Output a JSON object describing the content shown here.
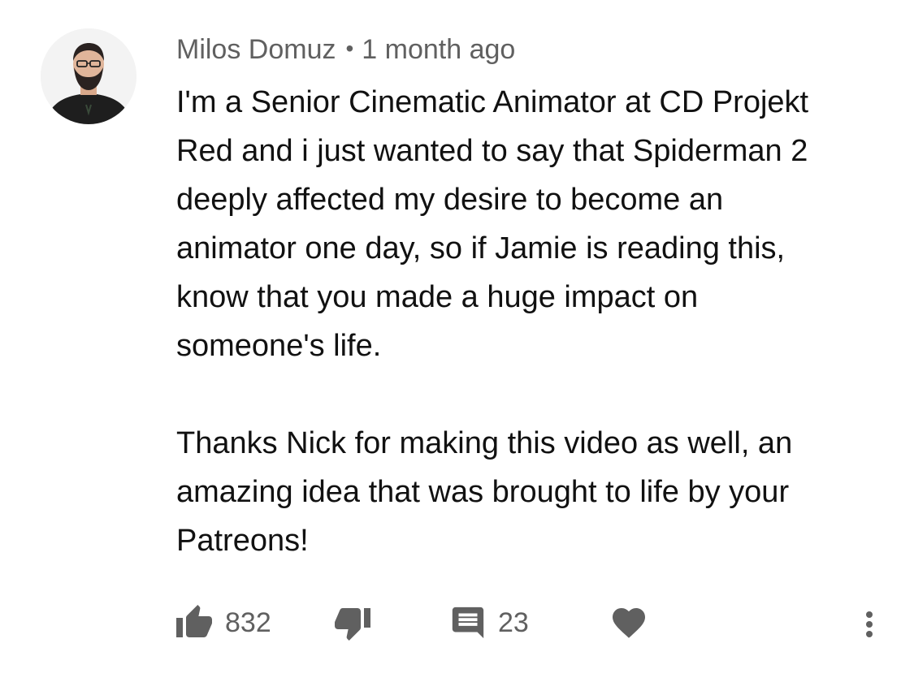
{
  "comment": {
    "author": "Milos Domuz",
    "separator": "•",
    "timestamp": "1 month ago",
    "paragraph1_lines": [
      "I'm a Senior Cinematic Animator at CD Projekt",
      "Red and i just wanted to say that Spiderman 2",
      "deeply affected my desire to become an",
      "animator one day, so if Jamie is reading this,",
      "know that you made a huge impact on",
      "someone's life."
    ],
    "paragraph2_lines": [
      "Thanks Nick for making this video as well, an",
      "amazing idea that was brought to life by your",
      "Patreons!"
    ]
  },
  "actions": {
    "like_icon": "thumbs-up-icon",
    "like_count": "832",
    "dislike_icon": "thumbs-down-icon",
    "reply_icon": "comment-icon",
    "reply_count": "23",
    "heart_icon": "heart-icon",
    "more_icon": "more-vertical-icon"
  },
  "colors": {
    "text_primary": "#111111",
    "text_secondary": "#606060",
    "icon": "#606060"
  }
}
